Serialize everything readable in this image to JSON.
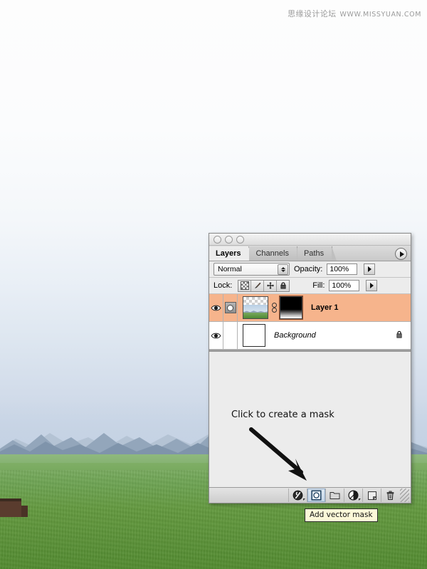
{
  "watermark": {
    "site_name": "思缘设计论坛",
    "url": "WWW.MISSYUAN.COM"
  },
  "panel": {
    "window_controls": [
      "close",
      "minimize",
      "zoom"
    ],
    "tabs": [
      {
        "label": "Layers",
        "active": true
      },
      {
        "label": "Channels",
        "active": false
      },
      {
        "label": "Paths",
        "active": false
      }
    ],
    "menu_icon": "panel-menu-arrow-icon",
    "options": {
      "blend_mode": "Normal",
      "opacity_label": "Opacity:",
      "opacity_value": "100%",
      "lock_label": "Lock:",
      "lock_buttons": [
        "lock-transparent-pixels-icon",
        "lock-image-pixels-icon",
        "lock-position-icon",
        "lock-all-icon"
      ],
      "fill_label": "Fill:",
      "fill_value": "100%"
    },
    "layers": [
      {
        "name": "Layer 1",
        "selected": true,
        "visible": true,
        "has_vector_mask_indicator": true,
        "thumbnail": "layer-photo-thumbnail",
        "mask_thumbnail": "gradient-mask-thumbnail",
        "linked": true,
        "locked": false,
        "italic": false
      },
      {
        "name": "Background",
        "selected": false,
        "visible": true,
        "has_vector_mask_indicator": false,
        "thumbnail": "white-layer-thumbnail",
        "mask_thumbnail": null,
        "linked": false,
        "locked": true,
        "italic": true
      }
    ],
    "hint": {
      "text": "Click to create a mask",
      "arrow": "down-right-arrow-annotation"
    },
    "footer_buttons": [
      {
        "name": "layer-style-button",
        "icon": "fx-circle-icon",
        "has_caret": true,
        "selected": false
      },
      {
        "name": "add-vector-mask-button",
        "icon": "mask-square-icon",
        "has_caret": false,
        "selected": true
      },
      {
        "name": "new-group-button",
        "icon": "folder-icon",
        "has_caret": false,
        "selected": false
      },
      {
        "name": "new-adjustment-layer-button",
        "icon": "half-circle-icon",
        "has_caret": true,
        "selected": false
      },
      {
        "name": "new-layer-button",
        "icon": "new-page-icon",
        "has_caret": false,
        "selected": false
      },
      {
        "name": "delete-layer-button",
        "icon": "trash-icon",
        "has_caret": false,
        "selected": false
      }
    ],
    "tooltip": "Add vector mask"
  },
  "colors": {
    "selected_layer_bg": "#f6b48c",
    "panel_bg": "#ececec",
    "tooltip_bg": "#fcf8d8",
    "highlight_blue": "#c3d4e6"
  }
}
